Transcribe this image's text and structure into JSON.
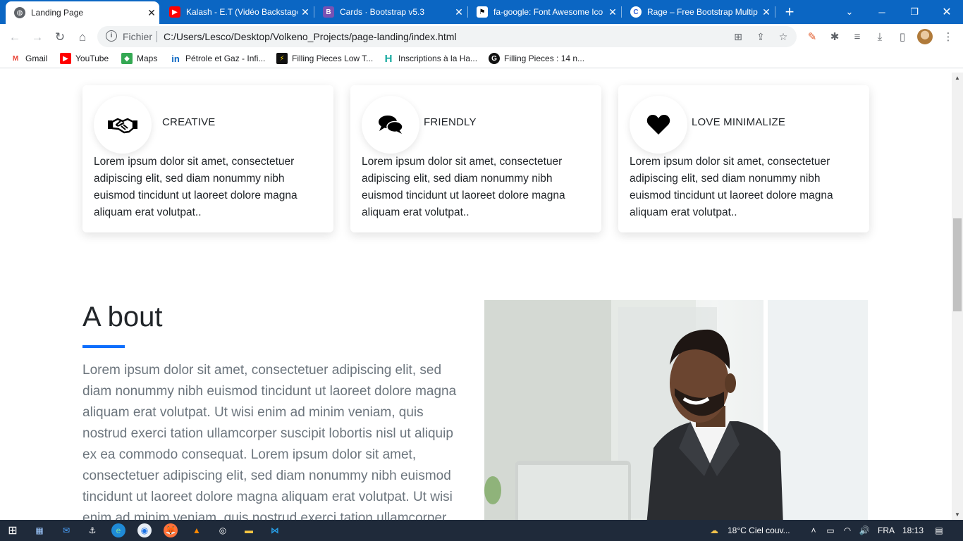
{
  "tabs": [
    {
      "title": "Landing Page",
      "active": true
    },
    {
      "title": "Kalash - E.T (Vidéo Backstage"
    },
    {
      "title": "Cards · Bootstrap v5.3"
    },
    {
      "title": "fa-google: Font Awesome Ico"
    },
    {
      "title": "Rage – Free Bootstrap Multip"
    }
  ],
  "toolbar": {
    "scheme": "Fichier",
    "url": "C:/Users/Lesco/Desktop/Volkeno_Projects/page-landing/index.html"
  },
  "bookmarks": [
    "Gmail",
    "YouTube",
    "Maps",
    "Pétrole et Gaz - Infi...",
    "Filling Pieces Low T...",
    "Inscriptions à la Ha...",
    "Filling Pieces : 14 n..."
  ],
  "cards": [
    {
      "title": "CREATIVE",
      "icon": "handshake-icon",
      "text": "Lorem ipsum dolor sit amet, consectetuer adipiscing elit, sed diam nonummy nibh euismod tincidunt ut laoreet dolore magna aliquam erat volutpat.."
    },
    {
      "title": "FRIENDLY",
      "icon": "comments-icon",
      "text": "Lorem ipsum dolor sit amet, consectetuer adipiscing elit, sed diam nonummy nibh euismod tincidunt ut laoreet dolore magna aliquam erat volutpat.."
    },
    {
      "title": "LOVE MINIMALIZE",
      "icon": "heart-icon",
      "text": "Lorem ipsum dolor sit amet, consectetuer adipiscing elit, sed diam nonummy nibh euismod tincidunt ut laoreet dolore magna aliquam erat volutpat.."
    }
  ],
  "about": {
    "title": "A bout",
    "accent": "#0d6efd",
    "text": "Lorem ipsum dolor sit amet, consectetuer adipiscing elit, sed diam nonummy nibh euismod tincidunt ut laoreet dolore magna aliquam erat volutpat. Ut wisi enim ad minim veniam, quis nostrud exerci tation ullamcorper suscipit lobortis nisl ut aliquip ex ea commodo consequat. Lorem ipsum dolor sit amet, consectetuer adipiscing elit, sed diam nonummy nibh euismod tincidunt ut laoreet dolore magna aliquam erat volutpat. Ut wisi enim ad minim veniam, quis nostrud exerci tation ullamcorper"
  },
  "taskbar": {
    "weather": "18°C  Ciel couv...",
    "lang": "FRA",
    "time": "18:13"
  },
  "colors": {
    "tabstrip": "#0b66c3",
    "taskbar": "#1f2a3a"
  }
}
